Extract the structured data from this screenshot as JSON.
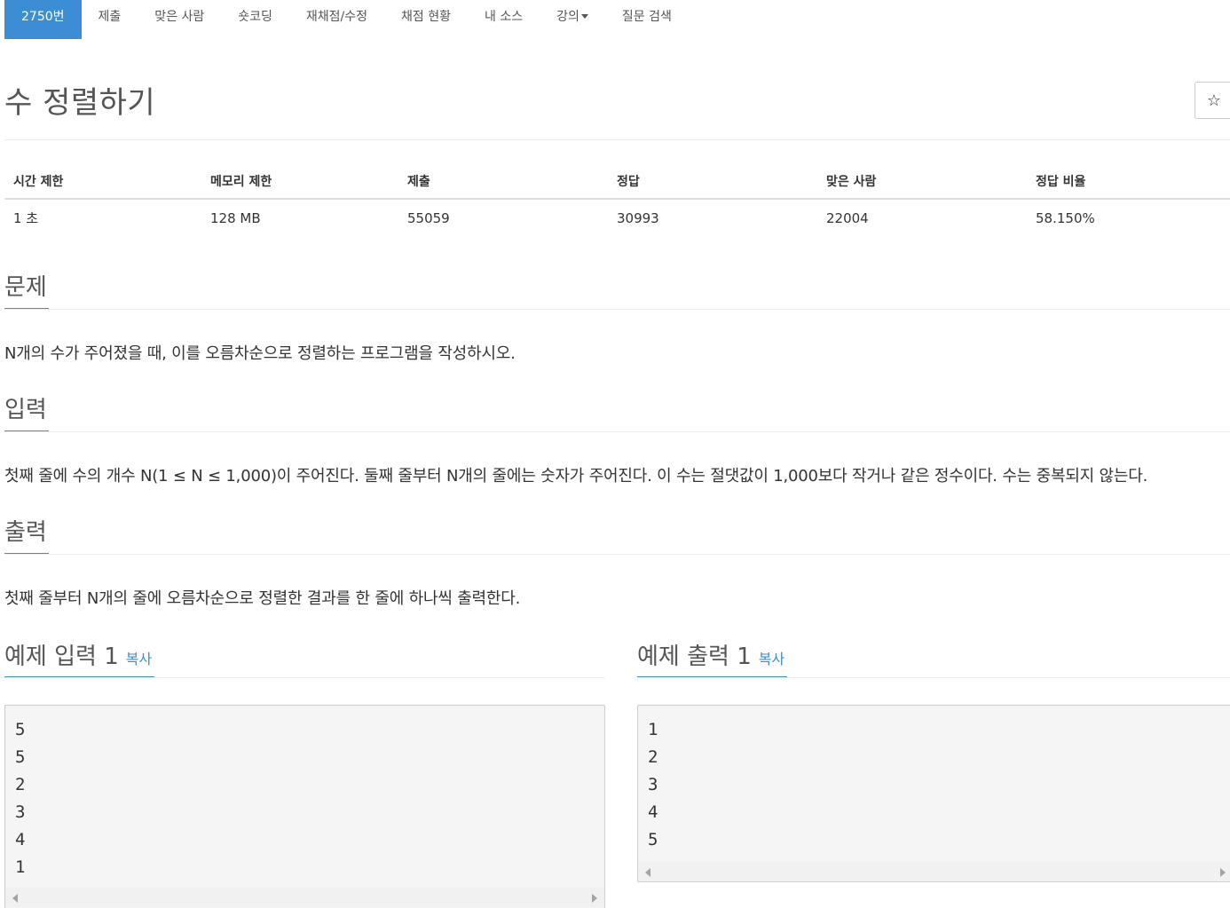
{
  "nav": {
    "tabs": [
      {
        "label": "2750번",
        "active": true
      },
      {
        "label": "제출"
      },
      {
        "label": "맞은 사람"
      },
      {
        "label": "숏코딩"
      },
      {
        "label": "재채점/수정"
      },
      {
        "label": "채점 현황"
      },
      {
        "label": "내 소스"
      },
      {
        "label": "강의",
        "dropdown": true
      },
      {
        "label": "질문 검색"
      }
    ]
  },
  "problem": {
    "title": "수 정렬하기",
    "star_icon": "☆"
  },
  "stats": {
    "headers": [
      "시간 제한",
      "메모리 제한",
      "제출",
      "정답",
      "맞은 사람",
      "정답 비율"
    ],
    "values": [
      "1 초",
      "128 MB",
      "55059",
      "30993",
      "22004",
      "58.150%"
    ]
  },
  "sections": {
    "problem_heading": "문제",
    "problem_text": "N개의 수가 주어졌을 때, 이를 오름차순으로 정렬하는 프로그램을 작성하시오.",
    "input_heading": "입력",
    "input_text": "첫째 줄에 수의 개수 N(1 ≤ N ≤ 1,000)이 주어진다. 둘째 줄부터 N개의 줄에는 숫자가 주어진다. 이 수는 절댓값이 1,000보다 작거나 같은 정수이다. 수는 중복되지 않는다.",
    "output_heading": "출력",
    "output_text": "첫째 줄부터 N개의 줄에 오름차순으로 정렬한 결과를 한 줄에 하나씩 출력한다."
  },
  "samples": {
    "input_heading": "예제 입력 1",
    "output_heading": "예제 출력 1",
    "copy_label": "복사",
    "input_lines": [
      "5",
      "5",
      "2",
      "3",
      "4",
      "1"
    ],
    "output_lines": [
      "1",
      "2",
      "3",
      "4",
      "5"
    ]
  },
  "colors": {
    "accent": "#3b8ed4",
    "nav_active_text": "#ffffff"
  }
}
